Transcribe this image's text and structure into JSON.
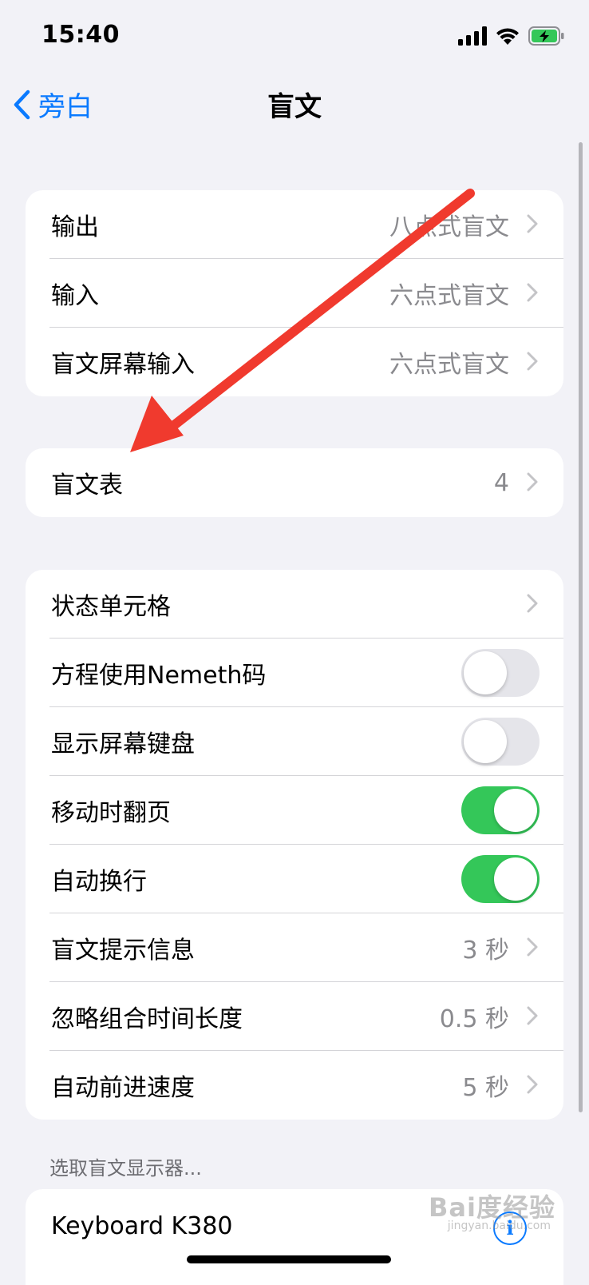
{
  "status": {
    "time": "15:40"
  },
  "nav": {
    "back_label": "旁白",
    "title": "盲文"
  },
  "group1": [
    {
      "label": "输出",
      "value": "八点式盲文"
    },
    {
      "label": "输入",
      "value": "六点式盲文"
    },
    {
      "label": "盲文屏幕输入",
      "value": "六点式盲文"
    }
  ],
  "group2": [
    {
      "label": "盲文表",
      "value": "4"
    }
  ],
  "group3": {
    "status_cells": {
      "label": "状态单元格"
    },
    "nemeth": {
      "label": "方程使用Nemeth码",
      "on": false
    },
    "onscreen_keyboard": {
      "label": "显示屏幕键盘",
      "on": false
    },
    "turn_pages": {
      "label": "移动时翻页",
      "on": true
    },
    "word_wrap": {
      "label": "自动换行",
      "on": true
    },
    "alert_messages": {
      "label": "盲文提示信息",
      "value": "3 秒"
    },
    "ignore_chord": {
      "label": "忽略组合时间长度",
      "value": "0.5 秒"
    },
    "auto_advance": {
      "label": "自动前进速度",
      "value": "5 秒"
    }
  },
  "devices": {
    "header": "选取盲文显示器...",
    "items": [
      {
        "label": "Keyboard K380"
      }
    ]
  },
  "watermark": {
    "text": "Bai度经验",
    "sub": "jingyan.baidu.com"
  },
  "colors": {
    "accent": "#0a7aff",
    "toggle_on": "#34c759",
    "annotation_arrow": "#f03a2e"
  }
}
